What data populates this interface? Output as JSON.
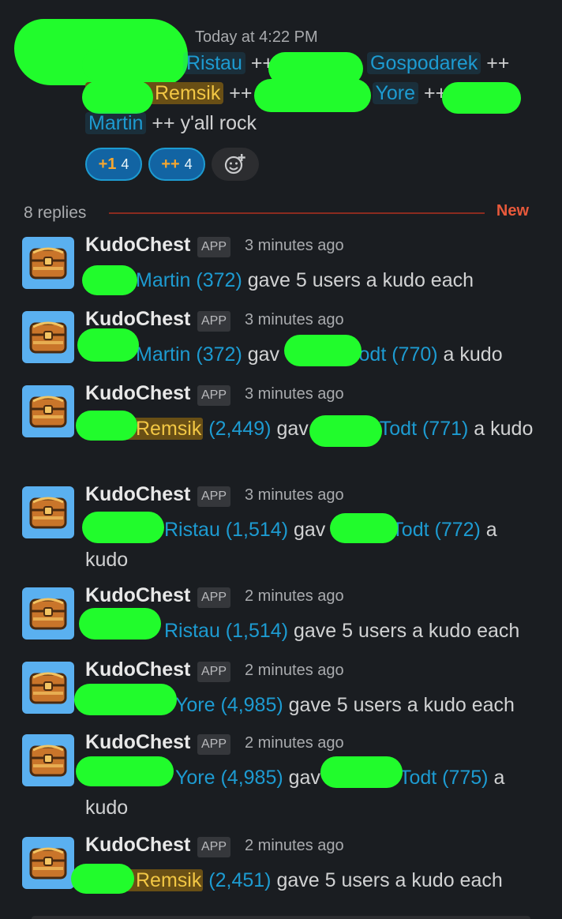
{
  "parent": {
    "time": "Today at 4:22 PM",
    "line1": {
      "m1": "Ristau",
      "sep1": "++",
      "m2": "Gospodarek",
      "sep2": "++"
    },
    "line2": {
      "m1": "Remsik",
      "sep1": "++",
      "m2": "Yore",
      "sep2": "++"
    },
    "line3": {
      "m1": "Martin",
      "rest": "++ y'all rock"
    },
    "reactions": [
      {
        "emoji": "+1",
        "count": "4"
      },
      {
        "emoji": "++",
        "count": "4"
      }
    ]
  },
  "thread": {
    "replies_label": "8 replies",
    "new_label": "New"
  },
  "replies": [
    {
      "author": "KudoChest",
      "badge": "APP",
      "time": "3 minutes ago",
      "a": "Martin (372)",
      "mid": " gave 5 users a kudo each",
      "b": "",
      "tail": ""
    },
    {
      "author": "KudoChest",
      "badge": "APP",
      "time": "3 minutes ago",
      "a": "Martin (372)",
      "mid": " gav",
      "b": "Todt (770)",
      "tail": " a kudo"
    },
    {
      "author": "KudoChest",
      "badge": "APP",
      "time": "3 minutes ago",
      "a": "Remsik",
      "a2": " (2,449)",
      "mid": " gav",
      "b": "Todt (771)",
      "tail": " a kudo"
    },
    {
      "author": "KudoChest",
      "badge": "APP",
      "time": "3 minutes ago",
      "a": "Ristau (1,514)",
      "mid": " gav",
      "b": "Todt (772)",
      "tail": " a kudo"
    },
    {
      "author": "KudoChest",
      "badge": "APP",
      "time": "2 minutes ago",
      "a": "Ristau (1,514)",
      "mid": " gave 5 users a kudo each",
      "b": "",
      "tail": ""
    },
    {
      "author": "KudoChest",
      "badge": "APP",
      "time": "2 minutes ago",
      "a": "Yore (4,985)",
      "mid": " gave 5 users a kudo each",
      "b": "",
      "tail": ""
    },
    {
      "author": "KudoChest",
      "badge": "APP",
      "time": "2 minutes ago",
      "a": "Yore (4,985)",
      "mid": " gav",
      "b": "Todt (775)",
      "tail": " a kudo"
    },
    {
      "author": "KudoChest",
      "badge": "APP",
      "time": "2 minutes ago",
      "a": "Remsik",
      "a2": " (2,451)",
      "mid": " gave 5 users a kudo each",
      "b": "",
      "tail": ""
    }
  ]
}
